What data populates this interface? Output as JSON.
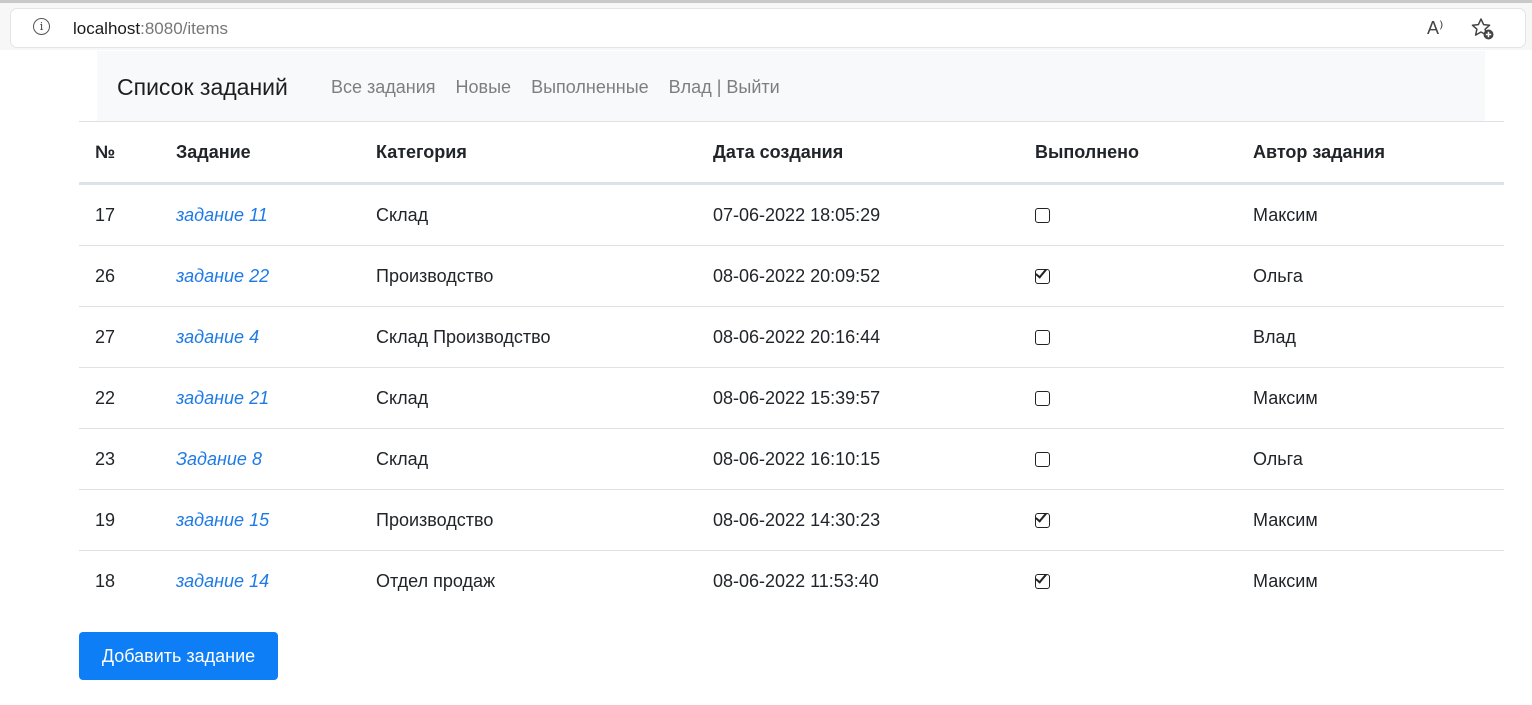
{
  "browser": {
    "url_host": "localhost",
    "url_rest": ":8080/items",
    "info_icon": "i",
    "read_aloud_icon": "A⁾",
    "favorite_icon": "star-add-icon"
  },
  "navbar": {
    "brand": "Список заданий",
    "links": [
      "Все задания",
      "Новые",
      "Выполненные",
      "Влад | Выйти"
    ]
  },
  "table": {
    "headers": [
      "№",
      "Задание",
      "Категория",
      "Дата создания",
      "Выполнено",
      "Автор задания"
    ],
    "rows": [
      {
        "id": "17",
        "task": "задание 11",
        "category": "Склад",
        "created": "07-06-2022 18:05:29",
        "done": false,
        "author": "Максим"
      },
      {
        "id": "26",
        "task": "задание 22",
        "category": "Производство",
        "created": "08-06-2022 20:09:52",
        "done": true,
        "author": "Ольга"
      },
      {
        "id": "27",
        "task": "задание 4",
        "category": "Склад Производство",
        "created": "08-06-2022 20:16:44",
        "done": false,
        "author": "Влад"
      },
      {
        "id": "22",
        "task": "задание 21",
        "category": "Склад",
        "created": "08-06-2022 15:39:57",
        "done": false,
        "author": "Максим"
      },
      {
        "id": "23",
        "task": "Задание 8",
        "category": "Склад",
        "created": "08-06-2022 16:10:15",
        "done": false,
        "author": "Ольга"
      },
      {
        "id": "19",
        "task": "задание 15",
        "category": "Производство",
        "created": "08-06-2022 14:30:23",
        "done": true,
        "author": "Максим"
      },
      {
        "id": "18",
        "task": "задание 14",
        "category": "Отдел продаж",
        "created": "08-06-2022 11:53:40",
        "done": true,
        "author": "Максим"
      }
    ]
  },
  "add_button": "Добавить задание",
  "colors": {
    "link": "#1d7ae6",
    "primary_button": "#0d7ef5",
    "navbar_bg": "#f8f9fa"
  }
}
